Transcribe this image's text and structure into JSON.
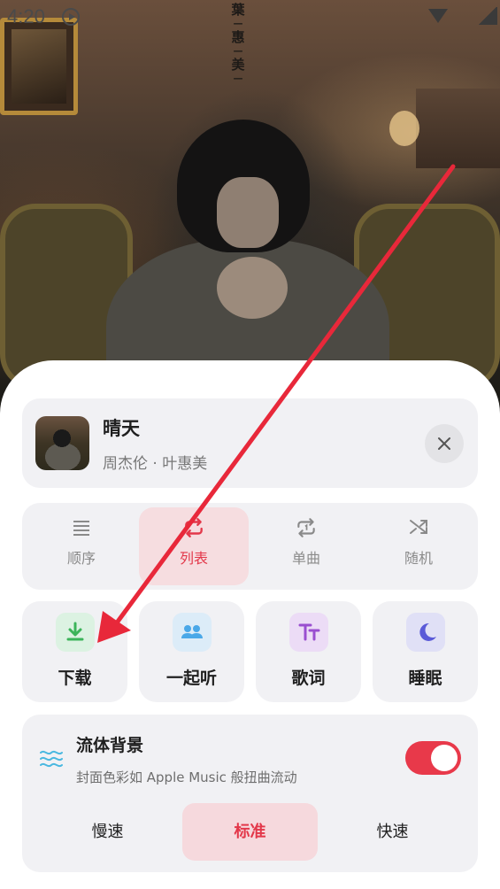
{
  "status_bar": {
    "time": "4:20"
  },
  "album_art": {
    "vertical_text": [
      "葉",
      "惠",
      "美"
    ]
  },
  "now_playing": {
    "title": "晴天",
    "artist": "周杰伦 · 叶惠美",
    "close_icon": "close-icon"
  },
  "play_modes": [
    {
      "label": "顺序",
      "icon": "list-order-icon",
      "active": false
    },
    {
      "label": "列表",
      "icon": "repeat-icon",
      "active": true
    },
    {
      "label": "单曲",
      "icon": "repeat-one-icon",
      "active": false
    },
    {
      "label": "随机",
      "icon": "shuffle-icon",
      "active": false
    }
  ],
  "features": [
    {
      "label": "下载",
      "icon": "download-icon",
      "color": "#3cb45a",
      "bg": "#dcf2e2"
    },
    {
      "label": "一起听",
      "icon": "people-icon",
      "color": "#4aa8e8",
      "bg": "#dcecf8"
    },
    {
      "label": "歌词",
      "icon": "lyrics-icon",
      "color": "#9a4fd0",
      "bg": "#ecdcf6"
    },
    {
      "label": "睡眠",
      "icon": "moon-icon",
      "color": "#5a5ad8",
      "bg": "#e0e0f6"
    }
  ],
  "fluid_background": {
    "title": "流体背景",
    "subtitle": "封面色彩如 Apple Music 般扭曲流动",
    "enabled": true,
    "icon": "wave-icon",
    "speeds": [
      {
        "label": "慢速",
        "active": false
      },
      {
        "label": "标准",
        "active": true
      },
      {
        "label": "快速",
        "active": false
      }
    ]
  },
  "colors": {
    "accent": "#e8394a",
    "annotation_arrow": "#e8283a"
  }
}
